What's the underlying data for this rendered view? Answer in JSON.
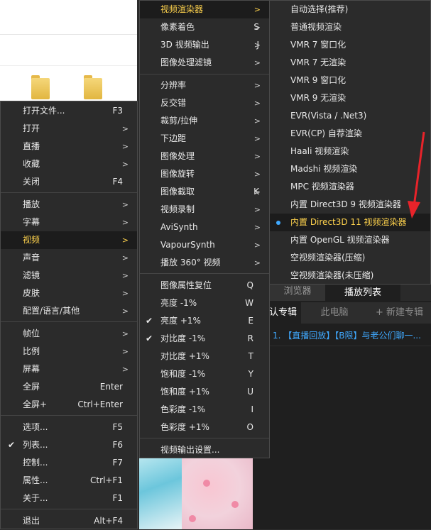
{
  "main_menu": {
    "items": [
      {
        "label": "打开文件...",
        "shortcut": "F3",
        "arrow": ""
      },
      {
        "label": "打开",
        "shortcut": "",
        "arrow": ">"
      },
      {
        "label": "直播",
        "shortcut": "",
        "arrow": ">"
      },
      {
        "label": "收藏",
        "shortcut": "",
        "arrow": ">"
      },
      {
        "label": "关闭",
        "shortcut": "F4",
        "arrow": ""
      },
      {
        "label": "播放",
        "shortcut": "",
        "arrow": ">"
      },
      {
        "label": "字幕",
        "shortcut": "",
        "arrow": ">"
      },
      {
        "label": "视频",
        "shortcut": "",
        "arrow": ">"
      },
      {
        "label": "声音",
        "shortcut": "",
        "arrow": ">"
      },
      {
        "label": "滤镜",
        "shortcut": "",
        "arrow": ">"
      },
      {
        "label": "皮肤",
        "shortcut": "",
        "arrow": ">"
      },
      {
        "label": "配置/语言/其他",
        "shortcut": "",
        "arrow": ">"
      },
      {
        "label": "帧位",
        "shortcut": "",
        "arrow": ">"
      },
      {
        "label": "比例",
        "shortcut": "",
        "arrow": ">"
      },
      {
        "label": "屏幕",
        "shortcut": "",
        "arrow": ">"
      },
      {
        "label": "全屏",
        "shortcut": "Enter",
        "arrow": ""
      },
      {
        "label": "全屏+",
        "shortcut": "Ctrl+Enter",
        "arrow": ""
      },
      {
        "label": "选项...",
        "shortcut": "F5",
        "arrow": ""
      },
      {
        "label": "列表...",
        "shortcut": "F6",
        "arrow": ""
      },
      {
        "label": "控制...",
        "shortcut": "F7",
        "arrow": ""
      },
      {
        "label": "属性...",
        "shortcut": "Ctrl+F1",
        "arrow": ""
      },
      {
        "label": "关于...",
        "shortcut": "F1",
        "arrow": ""
      },
      {
        "label": "退出",
        "shortcut": "Alt+F4",
        "arrow": ""
      }
    ]
  },
  "video_menu": {
    "items": [
      {
        "label": "视频渲染器",
        "shortcut": "",
        "arrow": ">"
      },
      {
        "label": "像素着色",
        "shortcut": "S",
        "arrow": ">"
      },
      {
        "label": "3D 视频输出",
        "shortcut": "J",
        "arrow": ">"
      },
      {
        "label": "图像处理滤镜",
        "shortcut": "",
        "arrow": ">"
      },
      {
        "label": "分辨率",
        "shortcut": "",
        "arrow": ">"
      },
      {
        "label": "反交错",
        "shortcut": "",
        "arrow": ">"
      },
      {
        "label": "裁剪/拉伸",
        "shortcut": "",
        "arrow": ">"
      },
      {
        "label": "下边距",
        "shortcut": "",
        "arrow": ">"
      },
      {
        "label": "图像处理",
        "shortcut": "",
        "arrow": ">"
      },
      {
        "label": "图像旋转",
        "shortcut": "",
        "arrow": ">"
      },
      {
        "label": "图像截取",
        "shortcut": "K",
        "arrow": ">"
      },
      {
        "label": "视频录制",
        "shortcut": "",
        "arrow": ">"
      },
      {
        "label": "AviSynth",
        "shortcut": "",
        "arrow": ">"
      },
      {
        "label": "VapourSynth",
        "shortcut": "",
        "arrow": ">"
      },
      {
        "label": "播放 360° 视频",
        "shortcut": "",
        "arrow": ">"
      },
      {
        "label": "图像属性复位",
        "shortcut": "Q",
        "arrow": ""
      },
      {
        "label": "亮度 -1%",
        "shortcut": "W",
        "arrow": ""
      },
      {
        "label": "亮度 +1%",
        "shortcut": "E",
        "arrow": ""
      },
      {
        "label": "对比度 -1%",
        "shortcut": "R",
        "arrow": ""
      },
      {
        "label": "对比度 +1%",
        "shortcut": "T",
        "arrow": ""
      },
      {
        "label": "饱和度 -1%",
        "shortcut": "Y",
        "arrow": ""
      },
      {
        "label": "饱和度 +1%",
        "shortcut": "U",
        "arrow": ""
      },
      {
        "label": "色彩度 -1%",
        "shortcut": "I",
        "arrow": ""
      },
      {
        "label": "色彩度 +1%",
        "shortcut": "O",
        "arrow": ""
      },
      {
        "label": "视频输出设置...",
        "shortcut": "",
        "arrow": ""
      }
    ]
  },
  "renderer_menu": {
    "items": [
      {
        "label": "自动选择(推荐)"
      },
      {
        "label": "普通视频渲染"
      },
      {
        "label": "VMR 7 窗口化"
      },
      {
        "label": "VMR 7 无渲染"
      },
      {
        "label": "VMR 9 窗口化"
      },
      {
        "label": "VMR 9 无渲染"
      },
      {
        "label": "EVR(Vista / .Net3)"
      },
      {
        "label": "EVR(CP) 自荐渲染"
      },
      {
        "label": "Haali 视频渲染"
      },
      {
        "label": "Madshi 视频渲染"
      },
      {
        "label": "MPC 视频渲染器"
      },
      {
        "label": "内置 Direct3D 9 视频渲染器"
      },
      {
        "label": "内置 Direct3D 11 视频渲染器"
      },
      {
        "label": "内置 OpenGL 视频渲染器"
      },
      {
        "label": "空视频渲染器(压缩)"
      },
      {
        "label": "空视频渲染器(未压缩)"
      }
    ]
  },
  "playlist_panel": {
    "tab_browser": "浏览器",
    "tab_playlist": "播放列表",
    "subtab_default": "认专辑",
    "subtab_pc": "此电脑",
    "subtab_new": "+ 新建专辑",
    "item": "1. 【直播回放】【B限】与老公们聊一..."
  },
  "colors": {
    "highlight_text": "#ffd34d",
    "playlist_link": "#3fa9ff",
    "radio_dot": "#3fa9ff",
    "annotation_arrow": "#e8232a"
  }
}
